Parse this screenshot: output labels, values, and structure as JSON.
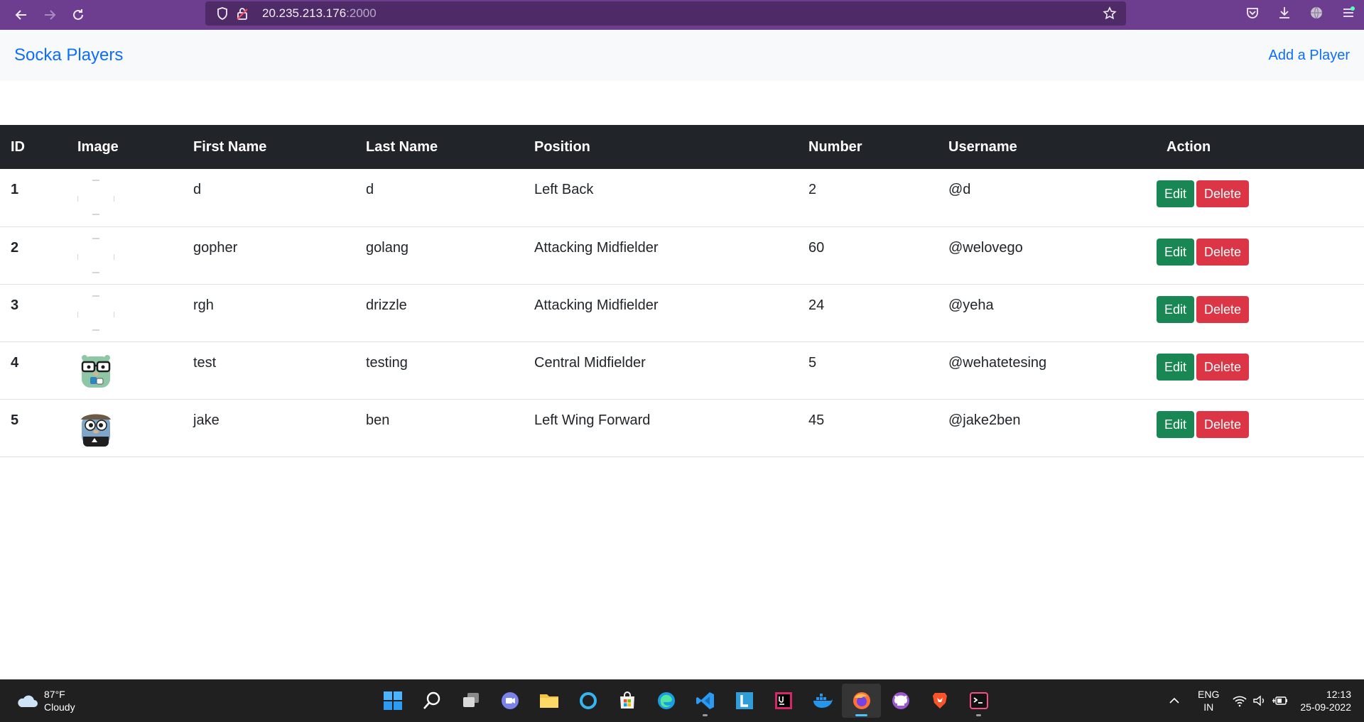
{
  "browser": {
    "url_host": "20.235.213.176",
    "url_port": ":2000"
  },
  "navbar": {
    "brand": "Socka Players",
    "add_link": "Add a Player"
  },
  "table": {
    "headers": [
      "ID",
      "Image",
      "First Name",
      "Last Name",
      "Position",
      "Number",
      "Username",
      "Action"
    ],
    "rows": [
      {
        "id": "1",
        "image": "broken-image-icon",
        "first_name": "d",
        "last_name": "d",
        "position": "Left Back",
        "number": "2",
        "username": "@d"
      },
      {
        "id": "2",
        "image": "broken-image-icon",
        "first_name": "gopher",
        "last_name": "golang",
        "position": "Attacking Midfielder",
        "number": "60",
        "username": "@welovego"
      },
      {
        "id": "3",
        "image": "broken-image-icon",
        "first_name": "rgh",
        "last_name": "drizzle",
        "position": "Attacking Midfielder",
        "number": "24",
        "username": "@yeha"
      },
      {
        "id": "4",
        "image": "gopher-glasses-avatar",
        "first_name": "test",
        "last_name": "testing",
        "position": "Central Midfielder",
        "number": "5",
        "username": "@wehatetesing"
      },
      {
        "id": "5",
        "image": "gopher-cap-avatar",
        "first_name": "jake",
        "last_name": "ben",
        "position": "Left Wing Forward",
        "number": "45",
        "username": "@jake2ben"
      }
    ],
    "edit_label": "Edit",
    "delete_label": "Delete"
  },
  "taskbar": {
    "weather_temp": "87°F",
    "weather_desc": "Cloudy",
    "lang_line1": "ENG",
    "lang_line2": "IN",
    "time": "12:13",
    "date": "25-09-2022",
    "apps": [
      "windows-start-icon",
      "search-icon",
      "task-view-icon",
      "teams-chat-icon",
      "file-explorer-icon",
      "cortana-icon",
      "ms-store-icon",
      "edge-icon",
      "vscode-icon",
      "l-app-icon",
      "intellij-icon",
      "docker-icon",
      "firefox-icon",
      "github-desktop-icon",
      "brave-icon",
      "terminal-icon"
    ]
  },
  "colors": {
    "primary": "#0d6efd",
    "success": "#198754",
    "danger": "#dc3545",
    "table_head": "#212529",
    "browser_bar": "#6d3d8f"
  }
}
